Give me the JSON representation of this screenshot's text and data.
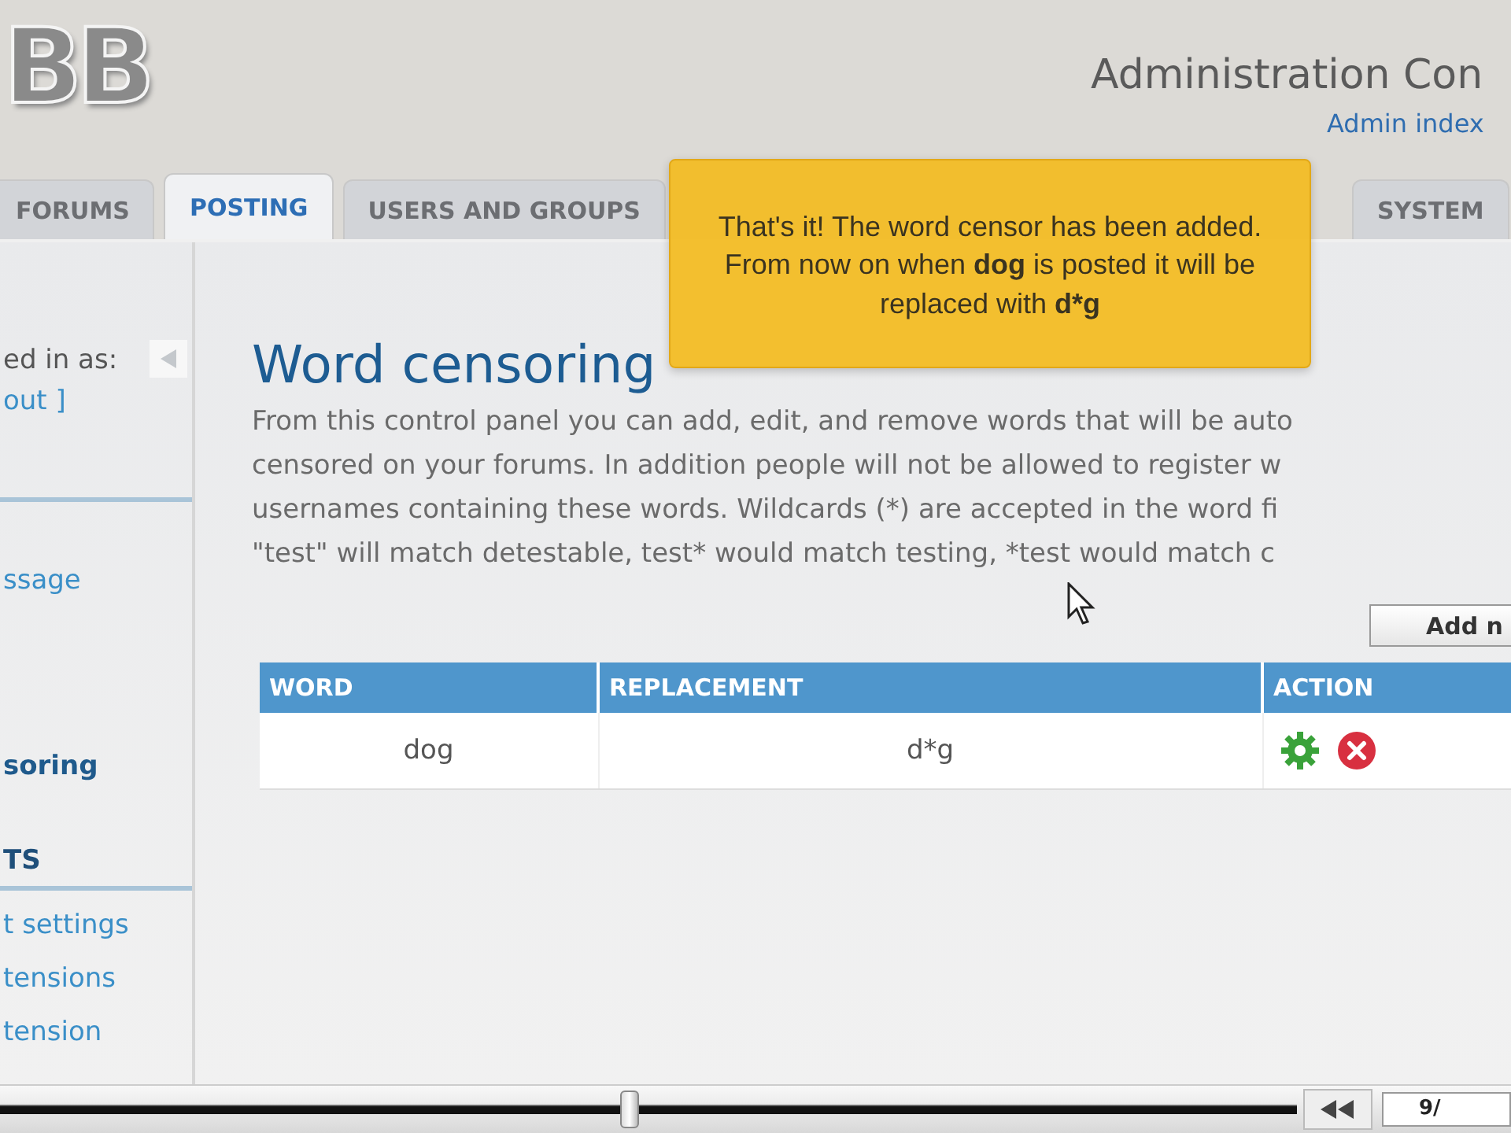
{
  "header": {
    "logo": "BB",
    "title": "Administration Con",
    "link": "Admin index"
  },
  "tabs": [
    {
      "label": "FORUMS",
      "selected": false
    },
    {
      "label": "POSTING",
      "selected": true
    },
    {
      "label": "USERS AND GROUPS",
      "selected": false
    },
    {
      "label": "SYSTEM",
      "selected": false
    }
  ],
  "sidebar": {
    "logged_in": "ed in as:",
    "logout": "out ]",
    "items": [
      {
        "label": "ssage",
        "kind": "link",
        "selected": false
      },
      {
        "label": "soring",
        "kind": "link",
        "selected": true
      },
      {
        "label": "TS",
        "kind": "heading",
        "selected": false
      },
      {
        "label": "t settings",
        "kind": "link",
        "selected": false
      },
      {
        "label": "tensions",
        "kind": "link",
        "selected": false
      },
      {
        "label": "tension",
        "kind": "link",
        "selected": false
      }
    ]
  },
  "page": {
    "title": "Word censoring",
    "description": [
      "From this control panel you can add, edit, and remove words that will be auto",
      "censored on your forums. In addition people will not be allowed to register w",
      "usernames containing these words. Wildcards (*) are accepted in the word fi",
      "\"test\" will match detestable, test* would match testing, *test would match c"
    ],
    "add_button": "Add n",
    "table": {
      "columns": [
        "WORD",
        "REPLACEMENT",
        "ACTION"
      ],
      "rows": [
        {
          "word": "dog",
          "replacement": "d*g"
        }
      ]
    }
  },
  "tooltip": [
    {
      "text": "That's it!  The word censor has been added.  From now on when ",
      "bold": false
    },
    {
      "text": "dog",
      "bold": true
    },
    {
      "text": " is posted it will be replaced with ",
      "bold": false
    },
    {
      "text": "d*g",
      "bold": true
    }
  ],
  "player": {
    "level": 0.485,
    "position": "9/"
  }
}
